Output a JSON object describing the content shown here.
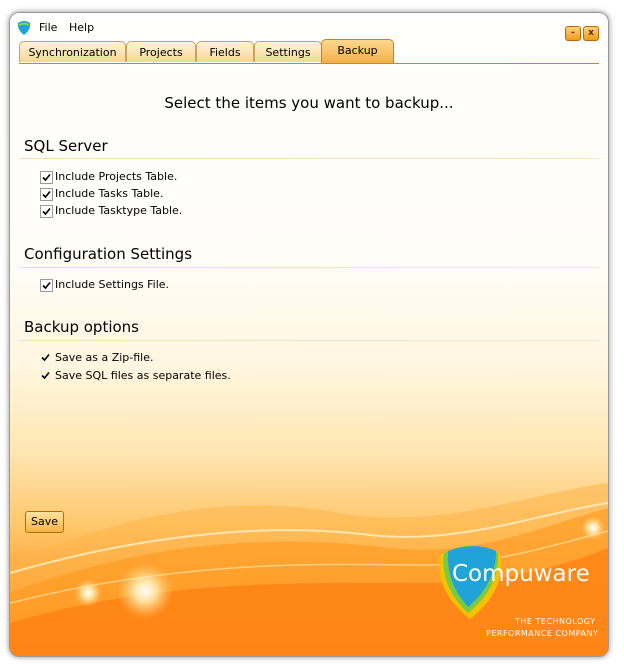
{
  "menu": {
    "file": "File",
    "help": "Help"
  },
  "window_buttons": {
    "minimize": "-",
    "close": "x"
  },
  "tabs": [
    {
      "label": "Synchronization",
      "active": false
    },
    {
      "label": "Projects",
      "active": false
    },
    {
      "label": "Fields",
      "active": false
    },
    {
      "label": "Settings",
      "active": false
    },
    {
      "label": "Backup",
      "active": true
    }
  ],
  "page": {
    "title": "Select the items you want to backup..."
  },
  "sections": {
    "sql_server": {
      "title": "SQL Server",
      "items": [
        {
          "label": "Include Projects Table.",
          "checked": true
        },
        {
          "label": "Include Tasks Table.",
          "checked": true
        },
        {
          "label": "Include Tasktype Table.",
          "checked": true
        }
      ]
    },
    "config": {
      "title": "Configuration Settings",
      "items": [
        {
          "label": "Include Settings File.",
          "checked": true
        }
      ]
    },
    "backup_options": {
      "title": "Backup options",
      "items": [
        {
          "label": "Save as a Zip-file.",
          "checked": true
        },
        {
          "label": "Save SQL files as separate files.",
          "checked": true
        }
      ]
    }
  },
  "save_button": {
    "label": "Save"
  },
  "logo": {
    "name": "Compuware",
    "tagline_1": "The Technology",
    "tagline_2": "Performance Company"
  },
  "colors": {
    "accent": "#f59a1e",
    "tab_active": "#f4b04a",
    "brand_blue": "#1fa3d8"
  }
}
